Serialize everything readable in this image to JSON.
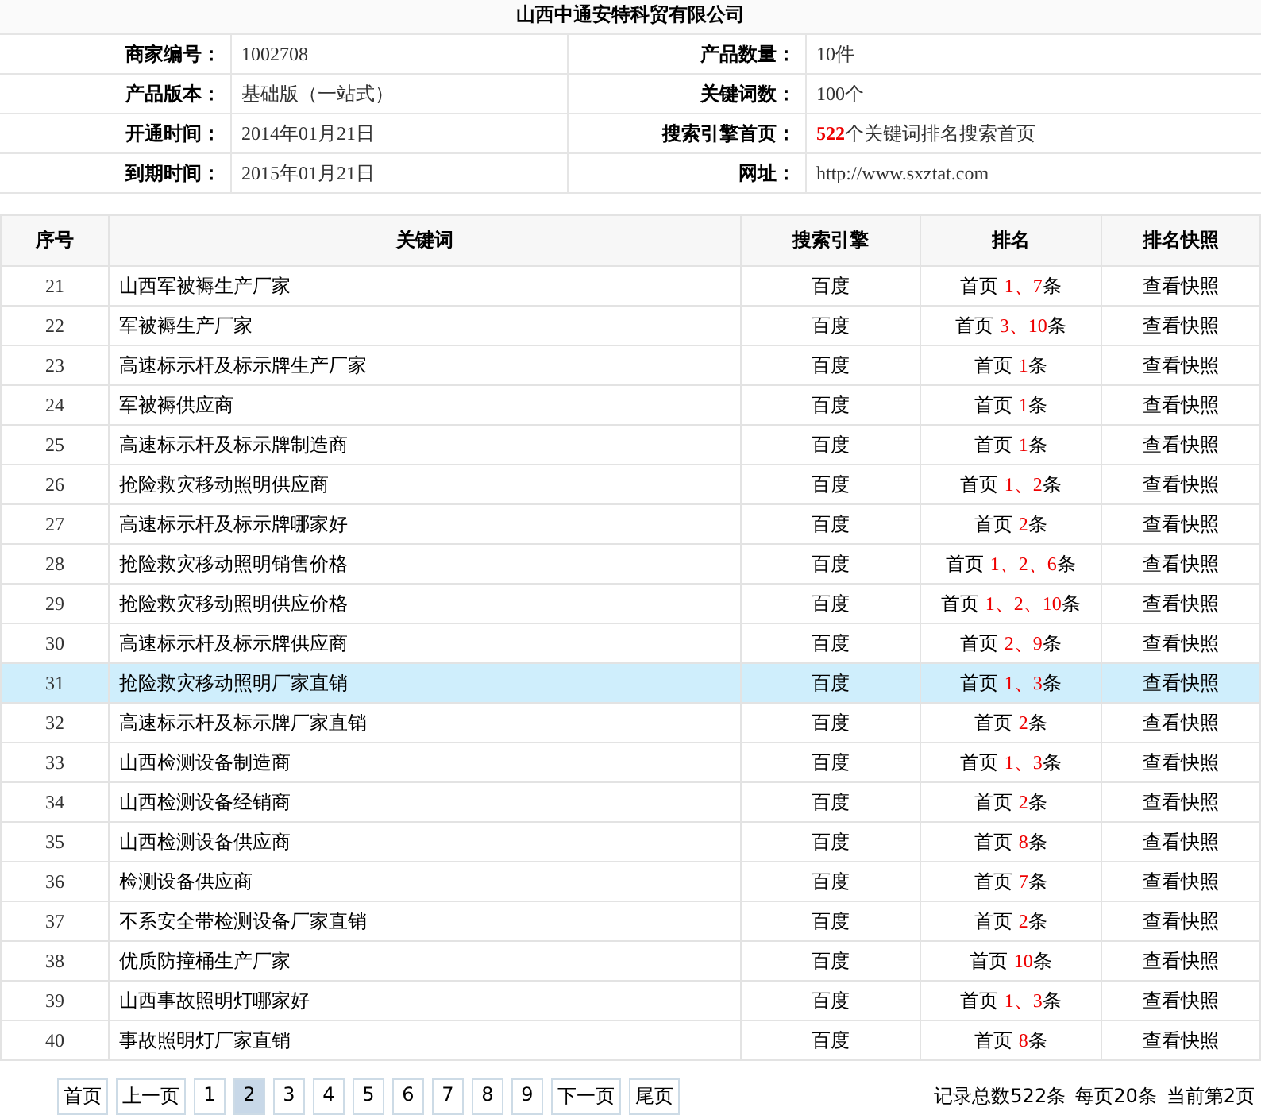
{
  "company": "山西中通安特科贸有限公司",
  "info": [
    {
      "label": "商家编号：",
      "value": "1002708"
    },
    {
      "label": "产品数量：",
      "value": "10件"
    },
    {
      "label": "产品版本：",
      "value": "基础版（一站式）"
    },
    {
      "label": "关键词数：",
      "value": "100个"
    },
    {
      "label": "开通时间：",
      "value": "2014年01月21日"
    },
    {
      "label": "搜索引擎首页：",
      "value": "**522**个关键词排名搜索首页"
    },
    {
      "label": "到期时间：",
      "value": "2015年01月21日"
    },
    {
      "label": "网址：",
      "value": "http://www.sxztat.com"
    }
  ],
  "table": {
    "columns": [
      "序号",
      "关键词",
      "搜索引擎",
      "排名",
      "排名快照"
    ],
    "rows": [
      {
        "no": "21",
        "keyword": "山西军被褥生产厂家",
        "engine": "百度",
        "rank_prefix": "首页",
        "rank": "1、7",
        "rank_suffix": "条",
        "snapshot": "查看快照",
        "selected": false
      },
      {
        "no": "22",
        "keyword": "军被褥生产厂家",
        "engine": "百度",
        "rank_prefix": "首页",
        "rank": "3、10",
        "rank_suffix": "条",
        "snapshot": "查看快照",
        "selected": false
      },
      {
        "no": "23",
        "keyword": "高速标示杆及标示牌生产厂家",
        "engine": "百度",
        "rank_prefix": "首页",
        "rank": "1",
        "rank_suffix": "条",
        "snapshot": "查看快照",
        "selected": false
      },
      {
        "no": "24",
        "keyword": "军被褥供应商",
        "engine": "百度",
        "rank_prefix": "首页",
        "rank": "1",
        "rank_suffix": "条",
        "snapshot": "查看快照",
        "selected": false
      },
      {
        "no": "25",
        "keyword": "高速标示杆及标示牌制造商",
        "engine": "百度",
        "rank_prefix": "首页",
        "rank": "1",
        "rank_suffix": "条",
        "snapshot": "查看快照",
        "selected": false
      },
      {
        "no": "26",
        "keyword": "抢险救灾移动照明供应商",
        "engine": "百度",
        "rank_prefix": "首页",
        "rank": "1、2",
        "rank_suffix": "条",
        "snapshot": "查看快照",
        "selected": false
      },
      {
        "no": "27",
        "keyword": "高速标示杆及标示牌哪家好",
        "engine": "百度",
        "rank_prefix": "首页",
        "rank": "2",
        "rank_suffix": "条",
        "snapshot": "查看快照",
        "selected": false
      },
      {
        "no": "28",
        "keyword": "抢险救灾移动照明销售价格",
        "engine": "百度",
        "rank_prefix": "首页",
        "rank": "1、2、6",
        "rank_suffix": "条",
        "snapshot": "查看快照",
        "selected": false
      },
      {
        "no": "29",
        "keyword": "抢险救灾移动照明供应价格",
        "engine": "百度",
        "rank_prefix": "首页",
        "rank": "1、2、10",
        "rank_suffix": "条",
        "snapshot": "查看快照",
        "selected": false
      },
      {
        "no": "30",
        "keyword": "高速标示杆及标示牌供应商",
        "engine": "百度",
        "rank_prefix": "首页",
        "rank": "2、9",
        "rank_suffix": "条",
        "snapshot": "查看快照",
        "selected": false
      },
      {
        "no": "31",
        "keyword": "抢险救灾移动照明厂家直销",
        "engine": "百度",
        "rank_prefix": "首页",
        "rank": "1、3",
        "rank_suffix": "条",
        "snapshot": "查看快照",
        "selected": true
      },
      {
        "no": "32",
        "keyword": "高速标示杆及标示牌厂家直销",
        "engine": "百度",
        "rank_prefix": "首页",
        "rank": "2",
        "rank_suffix": "条",
        "snapshot": "查看快照",
        "selected": false
      },
      {
        "no": "33",
        "keyword": "山西检测设备制造商",
        "engine": "百度",
        "rank_prefix": "首页",
        "rank": "1、3",
        "rank_suffix": "条",
        "snapshot": "查看快照",
        "selected": false
      },
      {
        "no": "34",
        "keyword": "山西检测设备经销商",
        "engine": "百度",
        "rank_prefix": "首页",
        "rank": "2",
        "rank_suffix": "条",
        "snapshot": "查看快照",
        "selected": false
      },
      {
        "no": "35",
        "keyword": "山西检测设备供应商",
        "engine": "百度",
        "rank_prefix": "首页",
        "rank": "8",
        "rank_suffix": "条",
        "snapshot": "查看快照",
        "selected": false
      },
      {
        "no": "36",
        "keyword": "检测设备供应商",
        "engine": "百度",
        "rank_prefix": "首页",
        "rank": "7",
        "rank_suffix": "条",
        "snapshot": "查看快照",
        "selected": false
      },
      {
        "no": "37",
        "keyword": "不系安全带检测设备厂家直销",
        "engine": "百度",
        "rank_prefix": "首页",
        "rank": "2",
        "rank_suffix": "条",
        "snapshot": "查看快照",
        "selected": false
      },
      {
        "no": "38",
        "keyword": "优质防撞桶生产厂家",
        "engine": "百度",
        "rank_prefix": "首页",
        "rank": "10",
        "rank_suffix": "条",
        "snapshot": "查看快照",
        "selected": false
      },
      {
        "no": "39",
        "keyword": "山西事故照明灯哪家好",
        "engine": "百度",
        "rank_prefix": "首页",
        "rank": "1、3",
        "rank_suffix": "条",
        "snapshot": "查看快照",
        "selected": false
      },
      {
        "no": "40",
        "keyword": "事故照明灯厂家直销",
        "engine": "百度",
        "rank_prefix": "首页",
        "rank": "8",
        "rank_suffix": "条",
        "snapshot": "查看快照",
        "selected": false
      }
    ]
  },
  "pagination": {
    "pages": [
      {
        "label": "首页",
        "selected": false
      },
      {
        "label": "上一页",
        "selected": false
      },
      {
        "label": "1",
        "selected": false
      },
      {
        "label": "2",
        "selected": true
      },
      {
        "label": "3",
        "selected": false
      },
      {
        "label": "4",
        "selected": false
      },
      {
        "label": "5",
        "selected": false
      },
      {
        "label": "6",
        "selected": false
      },
      {
        "label": "7",
        "selected": false
      },
      {
        "label": "8",
        "selected": false
      },
      {
        "label": "9",
        "selected": false
      },
      {
        "label": "下一页",
        "selected": false
      },
      {
        "label": "尾页",
        "selected": false
      }
    ],
    "summary": [
      "记录总数522条",
      "每页20条",
      "当前第2页"
    ]
  }
}
